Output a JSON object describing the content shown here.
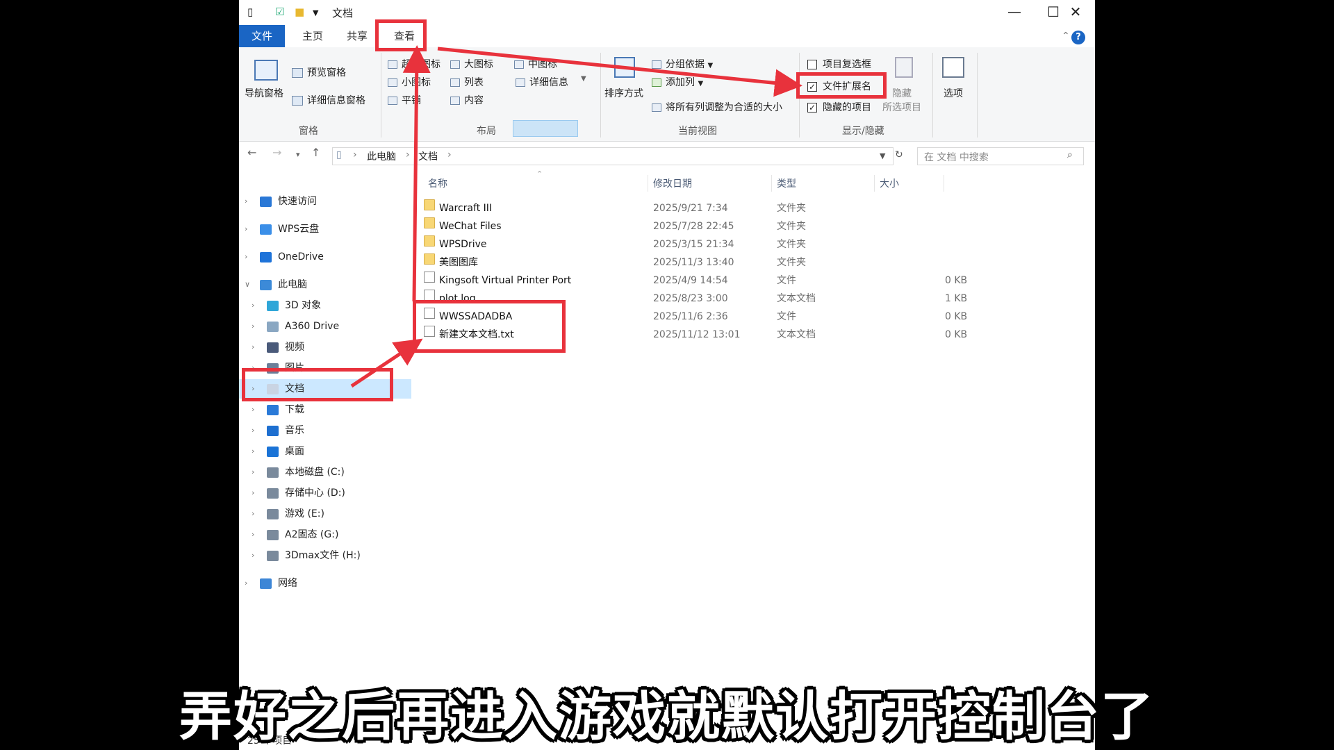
{
  "window": {
    "title": "文档",
    "controls": {
      "minimize": "—",
      "maximize": "☐",
      "close": "✕"
    }
  },
  "tabs": [
    "文件",
    "主页",
    "共享",
    "查看"
  ],
  "ribbon": {
    "pane": {
      "nav_pane": "导航窗格",
      "preview_pane": "预览窗格",
      "details_pane": "详细信息窗格",
      "group": "窗格"
    },
    "layout": {
      "items": [
        "超大图标",
        "大图标",
        "中图标",
        "小图标",
        "列表",
        "详细信息",
        "平铺",
        "内容"
      ],
      "group": "布局"
    },
    "current_view": {
      "sort_by": "排序方式",
      "group_by": "分组依据",
      "add_columns": "添加列",
      "size_all_columns": "将所有列调整为合适的大小",
      "group": "当前视图"
    },
    "show_hide": {
      "item_checkboxes": {
        "label": "项目复选框",
        "checked": false
      },
      "file_extensions": {
        "label": "文件扩展名",
        "checked": true
      },
      "hidden_items": {
        "label": "隐藏的项目",
        "checked": true
      },
      "hide": "隐藏",
      "selected_items": "所选项目",
      "group": "显示/隐藏"
    },
    "options": "选项"
  },
  "address": {
    "crumbs": [
      "此电脑",
      "文档"
    ],
    "search_placeholder": "在 文档 中搜索"
  },
  "tree": [
    {
      "label": "快速访问",
      "color": "#2a78d6"
    },
    {
      "label": "WPS云盘",
      "color": "#3b8fe8"
    },
    {
      "label": "OneDrive",
      "color": "#1e73d9"
    },
    {
      "label": "此电脑",
      "color": "#3c8ad8"
    },
    {
      "label": "3D 对象",
      "color": "#2fa6d8"
    },
    {
      "label": "A360 Drive",
      "color": "#8aa7c2"
    },
    {
      "label": "视频",
      "color": "#4a5a7a"
    },
    {
      "label": "图片",
      "color": "#6b7f99"
    },
    {
      "label": "文档",
      "color": "#c9d4e3"
    },
    {
      "label": "下载",
      "color": "#2a7ad8"
    },
    {
      "label": "音乐",
      "color": "#1e6fd0"
    },
    {
      "label": "桌面",
      "color": "#1a73d6"
    },
    {
      "label": "本地磁盘 (C:)",
      "color": "#7a8a9c"
    },
    {
      "label": "存储中心 (D:)",
      "color": "#7a8a9c"
    },
    {
      "label": "游戏 (E:)",
      "color": "#7a8a9c"
    },
    {
      "label": "A2固态 (G:)",
      "color": "#7a8a9c"
    },
    {
      "label": "3Dmax文件 (H:)",
      "color": "#7a8a9c"
    },
    {
      "label": "网络",
      "color": "#3d86d6"
    }
  ],
  "columns": [
    "名称",
    "修改日期",
    "类型",
    "大小"
  ],
  "files": [
    {
      "name": "Warcraft III",
      "date": "2025/9/21 7:34",
      "type": "文件夹",
      "size": "",
      "kind": "folder"
    },
    {
      "name": "WeChat Files",
      "date": "2025/7/28 22:45",
      "type": "文件夹",
      "size": "",
      "kind": "folder"
    },
    {
      "name": "WPSDrive",
      "date": "2025/3/15 21:34",
      "type": "文件夹",
      "size": "",
      "kind": "folder"
    },
    {
      "name": "美图图库",
      "date": "2025/11/3 13:40",
      "type": "文件夹",
      "size": "",
      "kind": "folder"
    },
    {
      "name": "Kingsoft Virtual Printer Port",
      "date": "2025/4/9 14:54",
      "type": "文件",
      "size": "0 KB",
      "kind": "file"
    },
    {
      "name": "plot.log",
      "date": "2025/8/23 3:00",
      "type": "文本文档",
      "size": "1 KB",
      "kind": "file"
    },
    {
      "name": "WWSSADADBA",
      "date": "2025/11/6 2:36",
      "type": "文件",
      "size": "0 KB",
      "kind": "file"
    },
    {
      "name": "新建文本文档.txt",
      "date": "2025/11/12 13:01",
      "type": "文本文档",
      "size": "0 KB",
      "kind": "file"
    }
  ],
  "status": "25 个项目",
  "subtitle": "弄好之后再进入游戏就默认打开控制台了",
  "colors": {
    "accent": "#1a65c4",
    "annotation": "#e8323c",
    "selection": "#cce8ff"
  }
}
